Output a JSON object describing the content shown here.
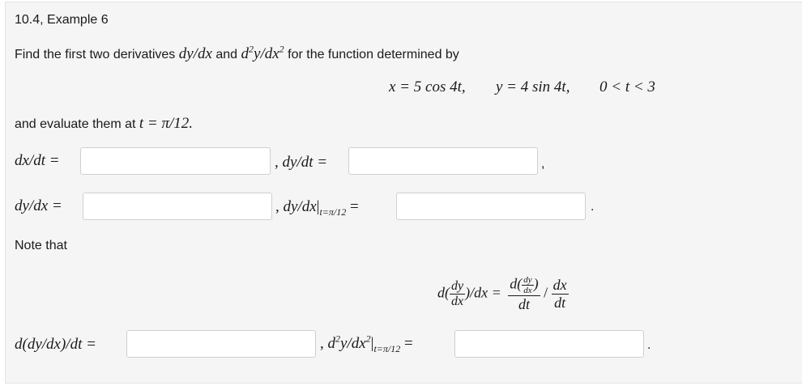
{
  "title": "10.4, Example 6",
  "intro": {
    "prefix": "Find the first two derivatives",
    "d1": "dy/dx",
    "and": "and",
    "d2_base": "d",
    "d2_sup": "2",
    "d2_mid": "y/dx",
    "d2_sup2": "2",
    "suffix": "for the function determined by"
  },
  "equation": {
    "x_part": "x = 5 cos 4t,",
    "y_part": "y = 4 sin 4t,",
    "domain": "0 < t < 3"
  },
  "evaluate": {
    "text": "and evaluate them at",
    "point": "t = π/12."
  },
  "labels": {
    "dxdt": "dx/dt =",
    "dydt": "dy/dt =",
    "dydx": "dy/dx =",
    "dydx_at": "dy/dx",
    "dydx_at_sub": "t=π/12",
    "eq": "=",
    "ddydx_dt": "d(dy/dx)/dt =",
    "d2ydx2": "d",
    "d2ydx2_sup": "2",
    "d2ydx2_mid": "y/dx",
    "d2ydx2_sup2": "2",
    "d2ydx2_sub": "t=π/12"
  },
  "note": "Note that",
  "punct": {
    "comma": ",",
    "period": "."
  },
  "formula": {
    "lhs_d": "d(",
    "lhs_num": "dy",
    "lhs_den": "dx",
    "lhs_tail": ")/dx =",
    "rhs_num_pre": "d(",
    "rhs_num_inner_num": "dy",
    "rhs_num_inner_den": "dx",
    "rhs_num_post": ")",
    "rhs_den": "dt",
    "slash": "/",
    "div_num": "dx",
    "div_den": "dt"
  },
  "inputs": {
    "dxdt": "",
    "dydt": "",
    "dydx": "",
    "dydx_at": "",
    "ddydx_dt": "",
    "d2ydx2_at": ""
  }
}
